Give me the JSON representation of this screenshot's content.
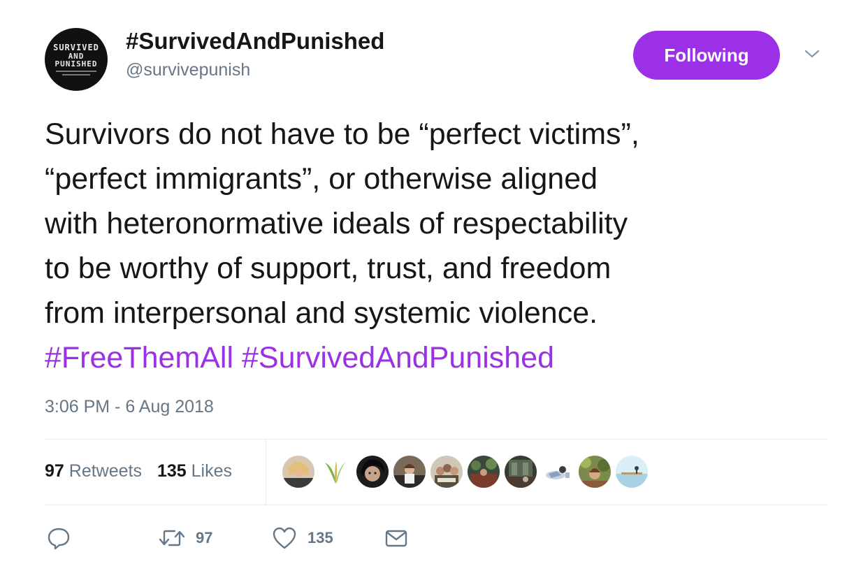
{
  "account": {
    "display_name": "#SurvivedAndPunished",
    "handle": "@survivepunish",
    "avatar": {
      "line1": "SURVIVED",
      "line2": "AND",
      "line3": "PUNISHED"
    }
  },
  "follow_button": {
    "label": "Following"
  },
  "tweet": {
    "lines": [
      "Survivors do not have to be “perfect victims”,",
      "“perfect immigrants”, or otherwise aligned",
      "with heteronormative ideals of respectability",
      "to be worthy of support, trust, and freedom",
      "from interpersonal and systemic violence."
    ],
    "hashtags": [
      "#FreeThemAll",
      "#SurvivedAndPunished"
    ],
    "timestamp": "3:06 PM - 6 Aug 2018"
  },
  "stats": {
    "retweets_count": "97",
    "retweets_label": "Retweets",
    "likes_count": "135",
    "likes_label": "Likes"
  },
  "actions": {
    "retweet_count": "97",
    "like_count": "135"
  },
  "colors": {
    "accent": "#9b30e6",
    "text": "#14171a",
    "secondary": "#657786",
    "divider": "#e6ecf0"
  },
  "icons": [
    "reply-icon",
    "retweet-icon",
    "heart-icon",
    "envelope-icon",
    "chevron-down-icon"
  ]
}
